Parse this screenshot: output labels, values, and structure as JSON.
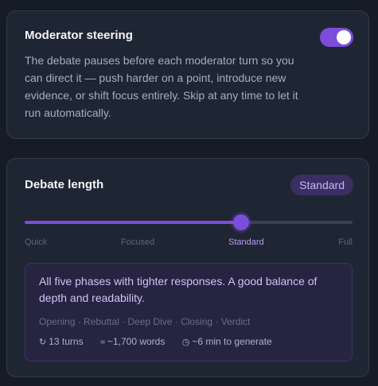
{
  "steering": {
    "title": "Moderator steering",
    "description": "The debate pauses before each moderator turn so you can direct it — push harder on a point, introduce new evidence, or shift focus entirely. Skip at any time to let it run automatically.",
    "toggle_on": true
  },
  "length": {
    "title": "Debate length",
    "badge": "Standard",
    "slider": {
      "options": [
        "Quick",
        "Focused",
        "Standard",
        "Full"
      ],
      "selected_index": 2,
      "value_fraction": 0.66
    },
    "info": {
      "description": "All five phases with tighter responses. A good balance of depth and readability.",
      "phases": "Opening · Rebuttal · Deep Dive · Closing · Verdict",
      "stats": [
        {
          "icon": "turns-icon",
          "glyph": "↻",
          "text": "13 turns"
        },
        {
          "icon": "words-icon",
          "glyph": "≈",
          "text": "~1,700 words"
        },
        {
          "icon": "clock-icon",
          "glyph": "◷",
          "text": "~6 min to generate"
        }
      ]
    }
  },
  "colors": {
    "accent": "#7c4ddb",
    "background": "#151b27",
    "card": "#1f2633",
    "info_box": "#272442"
  }
}
